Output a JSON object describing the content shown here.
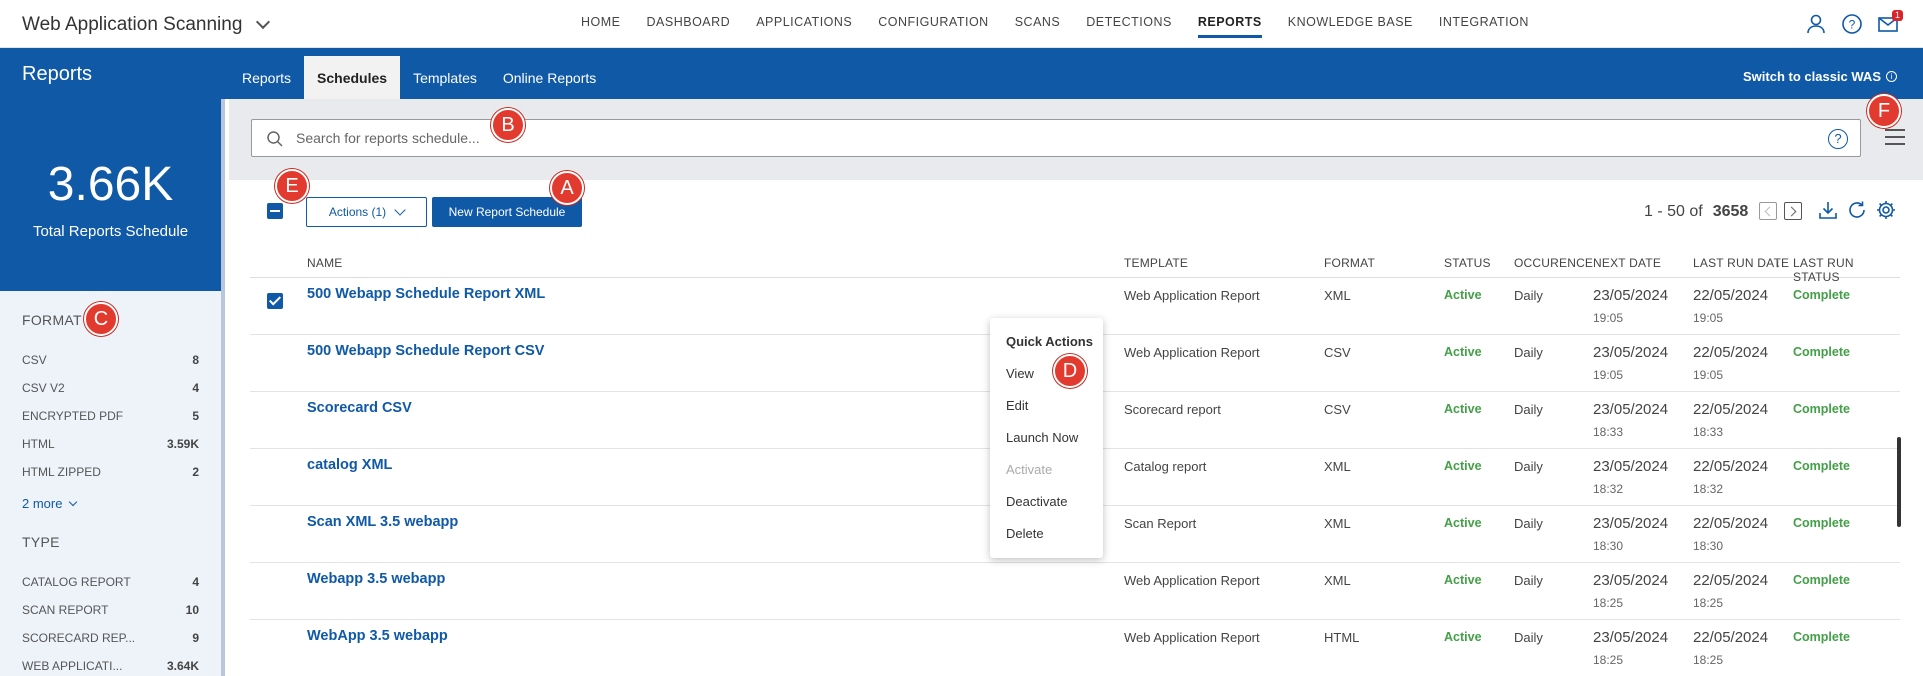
{
  "app": {
    "title": "Web Application Scanning"
  },
  "topnav": [
    {
      "label": "HOME"
    },
    {
      "label": "DASHBOARD"
    },
    {
      "label": "APPLICATIONS"
    },
    {
      "label": "CONFIGURATION"
    },
    {
      "label": "SCANS"
    },
    {
      "label": "DETECTIONS"
    },
    {
      "label": "REPORTS"
    },
    {
      "label": "KNOWLEDGE BASE"
    },
    {
      "label": "INTEGRATION"
    }
  ],
  "topnav_active": "REPORTS",
  "notifications": {
    "count": "1"
  },
  "section": {
    "title": "Reports",
    "switch_label": "Switch to classic WAS"
  },
  "subtabs": [
    {
      "label": "Reports"
    },
    {
      "label": "Schedules"
    },
    {
      "label": "Templates"
    },
    {
      "label": "Online Reports"
    }
  ],
  "subtab_active": "Schedules",
  "stats": {
    "value": "3.66K",
    "label": "Total Reports Schedule"
  },
  "facets": {
    "format": {
      "title": "FORMAT",
      "items": [
        {
          "label": "CSV",
          "count": "8"
        },
        {
          "label": "CSV V2",
          "count": "4"
        },
        {
          "label": "ENCRYPTED PDF",
          "count": "5"
        },
        {
          "label": "HTML",
          "count": "3.59K"
        },
        {
          "label": "HTML ZIPPED",
          "count": "2"
        }
      ],
      "more": "2 more"
    },
    "type": {
      "title": "TYPE",
      "items": [
        {
          "label": "CATALOG REPORT",
          "count": "4"
        },
        {
          "label": "SCAN REPORT",
          "count": "10"
        },
        {
          "label": "SCORECARD REP...",
          "count": "9"
        },
        {
          "label": "WEB APPLICATI...",
          "count": "3.64K"
        }
      ]
    }
  },
  "search": {
    "placeholder": "Search for reports schedule..."
  },
  "toolbar": {
    "actions_label": "Actions (1)",
    "new_label": "New Report Schedule"
  },
  "pagination": {
    "range": "1 - 50 of",
    "total": "3658"
  },
  "table": {
    "columns": {
      "name": "NAME",
      "template": "TEMPLATE",
      "format": "FORMAT",
      "status": "STATUS",
      "occurence": "OCCURENCE",
      "next_date": "NEXT DATE",
      "last_run_date": "LAST RUN DATE",
      "last_run_status": "LAST RUN STATUS"
    },
    "rows": [
      {
        "name": "500 Webapp Schedule Report XML",
        "template": "Web Application Report",
        "format": "XML",
        "status": "Active",
        "occurence": "Daily",
        "next_date": "23/05/2024",
        "next_time": "19:05",
        "last_date": "22/05/2024",
        "last_time": "19:05",
        "last_status": "Complete",
        "checked": true
      },
      {
        "name": "500 Webapp Schedule Report CSV",
        "template": "Web Application Report",
        "format": "CSV",
        "status": "Active",
        "occurence": "Daily",
        "next_date": "23/05/2024",
        "next_time": "19:05",
        "last_date": "22/05/2024",
        "last_time": "19:05",
        "last_status": "Complete",
        "checked": false
      },
      {
        "name": "Scorecard CSV",
        "template": "Scorecard report",
        "format": "CSV",
        "status": "Active",
        "occurence": "Daily",
        "next_date": "23/05/2024",
        "next_time": "18:33",
        "last_date": "22/05/2024",
        "last_time": "18:33",
        "last_status": "Complete",
        "checked": false
      },
      {
        "name": "catalog XML",
        "template": "Catalog report",
        "format": "XML",
        "status": "Active",
        "occurence": "Daily",
        "next_date": "23/05/2024",
        "next_time": "18:32",
        "last_date": "22/05/2024",
        "last_time": "18:32",
        "last_status": "Complete",
        "checked": false
      },
      {
        "name": "Scan XML 3.5 webapp",
        "template": "Scan Report",
        "format": "XML",
        "status": "Active",
        "occurence": "Daily",
        "next_date": "23/05/2024",
        "next_time": "18:30",
        "last_date": "22/05/2024",
        "last_time": "18:30",
        "last_status": "Complete",
        "checked": false
      },
      {
        "name": "Webapp 3.5 webapp",
        "template": "Web Application Report",
        "format": "XML",
        "status": "Active",
        "occurence": "Daily",
        "next_date": "23/05/2024",
        "next_time": "18:25",
        "last_date": "22/05/2024",
        "last_time": "18:25",
        "last_status": "Complete",
        "checked": false
      },
      {
        "name": "WebApp 3.5 webapp",
        "template": "Web Application Report",
        "format": "HTML",
        "status": "Active",
        "occurence": "Daily",
        "next_date": "23/05/2024",
        "next_time": "18:25",
        "last_date": "22/05/2024",
        "last_time": "18:25",
        "last_status": "Complete",
        "checked": false
      }
    ]
  },
  "quick_actions": {
    "title": "Quick Actions",
    "items": [
      {
        "label": "View",
        "disabled": false
      },
      {
        "label": "Edit",
        "disabled": false
      },
      {
        "label": "Launch Now",
        "disabled": false
      },
      {
        "label": "Activate",
        "disabled": true
      },
      {
        "label": "Deactivate",
        "disabled": false
      },
      {
        "label": "Delete",
        "disabled": false
      }
    ]
  },
  "callouts": {
    "a": "A",
    "b": "B",
    "c": "C",
    "d": "D",
    "e": "E",
    "f": "F"
  },
  "colors": {
    "brand_blue": "#0f59a6",
    "status_green": "#43a047",
    "callout_red": "#e23a2e"
  }
}
